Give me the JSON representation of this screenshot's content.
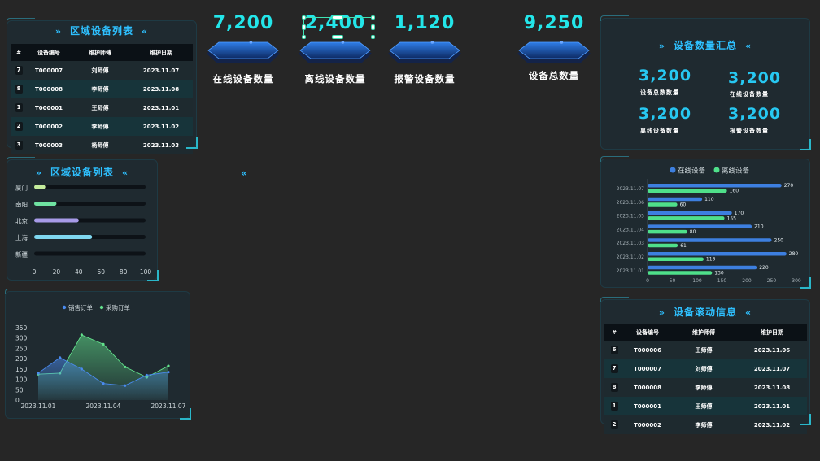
{
  "colors": {
    "background": "#262626",
    "accent": "#2ec0ff",
    "kpi": "#23e6ea",
    "online": "#3d7fe0",
    "offline": "#4fe08a"
  },
  "region_table": {
    "title": "区域设备列表",
    "headers": [
      "#",
      "设备编号",
      "维护师傅",
      "维护日期"
    ],
    "rows": [
      [
        "7",
        "T000007",
        "刘师傅",
        "2023.11.07"
      ],
      [
        "8",
        "T000008",
        "李师傅",
        "2023.11.08"
      ],
      [
        "1",
        "T000001",
        "王师傅",
        "2023.11.01"
      ],
      [
        "2",
        "T000002",
        "李师傅",
        "2023.11.02"
      ],
      [
        "3",
        "T000003",
        "杨师傅",
        "2023.11.03"
      ]
    ]
  },
  "region_bars": {
    "title": "区域设备列表",
    "chart_data": {
      "type": "bar",
      "categories": [
        "厦门",
        "南阳",
        "北京",
        "上海",
        "新疆"
      ],
      "values": [
        10,
        20,
        40,
        52,
        0
      ],
      "colors": [
        "#c4ec9c",
        "#6fe3a2",
        "#a79be8",
        "#7fd8f0",
        "#0d1217"
      ],
      "xlim": [
        0,
        100
      ],
      "xticks": [
        "0",
        "20",
        "40",
        "60",
        "80",
        "100"
      ]
    }
  },
  "orders_chart": {
    "legend": [
      "销售订单",
      "采购订单"
    ],
    "chart_data": {
      "type": "area",
      "x": [
        "2023.11.01",
        "2023.11.02",
        "2023.11.03",
        "2023.11.04",
        "2023.11.05",
        "2023.11.06",
        "2023.11.07"
      ],
      "xticks": [
        "2023.11.01",
        "2023.11.04",
        "2023.11.07"
      ],
      "series": [
        {
          "name": "销售订单",
          "values": [
            130,
            205,
            150,
            80,
            70,
            120,
            135
          ],
          "color": "#4a8bef"
        },
        {
          "name": "采购订单",
          "values": [
            125,
            130,
            315,
            270,
            160,
            110,
            165
          ],
          "color": "#62e28c"
        }
      ],
      "ylim": [
        0,
        350
      ],
      "yticks": [
        "0",
        "50",
        "100",
        "150",
        "200",
        "250",
        "300",
        "350"
      ]
    }
  },
  "kpis": [
    {
      "value": "7,200",
      "label": "在线设备数量"
    },
    {
      "value": "2,400",
      "label": "离线设备数量"
    },
    {
      "value": "1,120",
      "label": "报警设备数量"
    },
    {
      "value": "9,250",
      "label": "设备总数量"
    }
  ],
  "center_chevron": "«",
  "summary": {
    "title": "设备数量汇总",
    "items": [
      {
        "value": "3,200",
        "label": "设备总数数量"
      },
      {
        "value": "3,200",
        "label": "在线设备数量"
      },
      {
        "value": "3,200",
        "label": "离线设备数量"
      },
      {
        "value": "3,200",
        "label": "报警设备数量"
      }
    ]
  },
  "device_bars": {
    "legend": [
      "在线设备",
      "离线设备"
    ],
    "chart_data": {
      "type": "bar",
      "orientation": "horizontal",
      "categories": [
        "2023.11.07",
        "2023.11.06",
        "2023.11.05",
        "2023.11.04",
        "2023.11.03",
        "2023.11.02",
        "2023.11.01"
      ],
      "series": [
        {
          "name": "在线设备",
          "values": [
            270,
            110,
            170,
            210,
            250,
            280,
            220
          ],
          "color": "#3d7fe0"
        },
        {
          "name": "离线设备",
          "values": [
            160,
            60,
            155,
            80,
            61,
            113,
            130
          ],
          "color": "#4fe08a"
        }
      ],
      "xlim": [
        0,
        300
      ],
      "xticks": [
        "0",
        "50",
        "100",
        "150",
        "200",
        "250",
        "300"
      ]
    }
  },
  "scroll_table": {
    "title": "设备滚动信息",
    "headers": [
      "#",
      "设备编号",
      "维护师傅",
      "维护日期"
    ],
    "rows": [
      [
        "6",
        "T000006",
        "王师傅",
        "2023.11.06"
      ],
      [
        "7",
        "T000007",
        "刘师傅",
        "2023.11.07"
      ],
      [
        "8",
        "T000008",
        "李师傅",
        "2023.11.08"
      ],
      [
        "1",
        "T000001",
        "王师傅",
        "2023.11.01"
      ],
      [
        "2",
        "T000002",
        "李师傅",
        "2023.11.02"
      ]
    ]
  },
  "chevrons": {
    "left": "»",
    "right": "«"
  }
}
